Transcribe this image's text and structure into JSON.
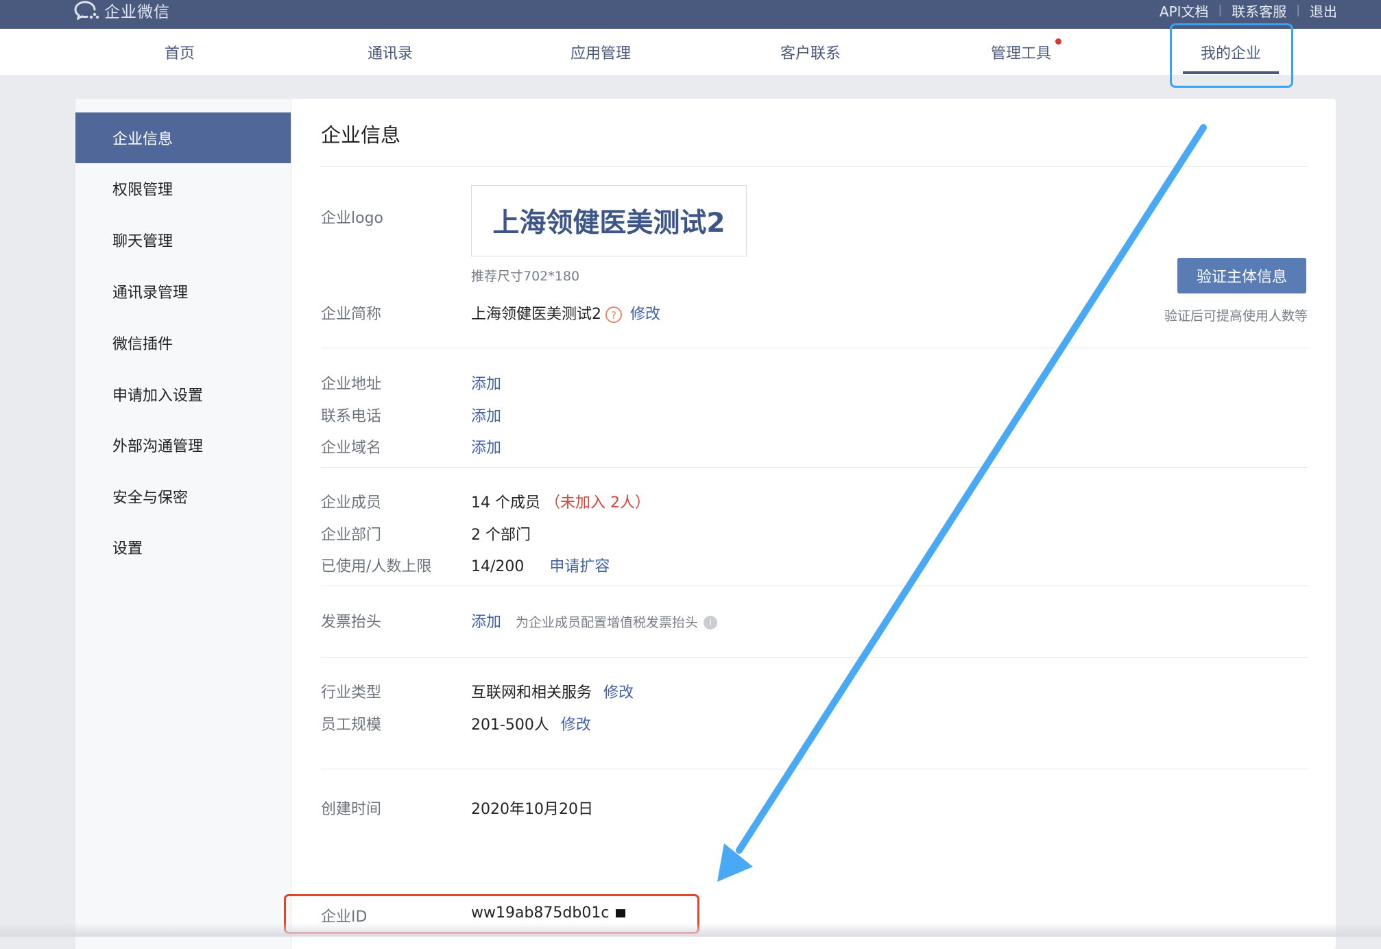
{
  "brand": {
    "name": "企业微信"
  },
  "top_links": [
    "API文档",
    "联系客服",
    "退出"
  ],
  "nav": {
    "items": [
      {
        "label": "首页"
      },
      {
        "label": "通讯录"
      },
      {
        "label": "应用管理"
      },
      {
        "label": "客户联系"
      },
      {
        "label": "管理工具"
      },
      {
        "label": "我的企业"
      }
    ],
    "active": "我的企业",
    "badge_on": "管理工具"
  },
  "sidebar": {
    "items": [
      {
        "label": "企业信息"
      },
      {
        "label": "权限管理"
      },
      {
        "label": "聊天管理"
      },
      {
        "label": "通讯录管理"
      },
      {
        "label": "微信插件"
      },
      {
        "label": "申请加入设置"
      },
      {
        "label": "外部沟通管理"
      },
      {
        "label": "安全与保密"
      },
      {
        "label": "设置"
      }
    ],
    "active": "企业信息"
  },
  "page": {
    "title": "企业信息",
    "logo": {
      "label": "企业logo",
      "text": "上海领健医美测试2",
      "hint": "推荐尺寸702*180"
    },
    "short_name": {
      "label": "企业简称",
      "value": "上海领健医美测试2",
      "help": "?",
      "action": "修改"
    },
    "verify": {
      "button": "验证主体信息",
      "hint": "验证后可提高使用人数等"
    },
    "address": {
      "label": "企业地址",
      "action": "添加"
    },
    "phone": {
      "label": "联系电话",
      "action": "添加"
    },
    "domain": {
      "label": "企业域名",
      "action": "添加"
    },
    "members": {
      "label": "企业成员",
      "value": "14 个成员",
      "not_joined": "（未加入 2人）"
    },
    "departments": {
      "label": "企业部门",
      "value": "2 个部门"
    },
    "quota": {
      "label": "已使用/人数上限",
      "value": "14/200",
      "action": "申请扩容"
    },
    "invoice": {
      "label": "发票抬头",
      "action": "添加",
      "hint": "为企业成员配置增值税发票抬头",
      "info": "i"
    },
    "industry": {
      "label": "行业类型",
      "value": "互联网和相关服务",
      "action": "修改"
    },
    "scale": {
      "label": "员工规模",
      "value": "201-500人",
      "action": "修改"
    },
    "created": {
      "label": "创建时间",
      "value": "2020年10月20日"
    },
    "corp_id": {
      "label": "企业ID",
      "value": "ww19ab875db01c"
    }
  },
  "annotations": {
    "nav_highlight_color": "#3aa2f3",
    "id_highlight_color": "#e0452f",
    "arrow_color": "#4aa9f5"
  }
}
